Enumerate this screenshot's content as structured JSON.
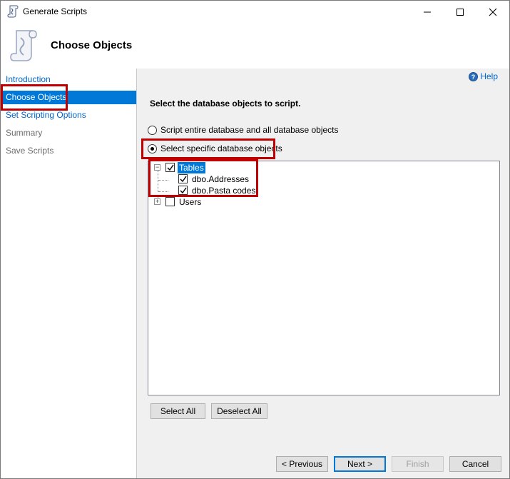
{
  "window": {
    "title": "Generate Scripts"
  },
  "header": {
    "title": "Choose Objects"
  },
  "nav": {
    "items": [
      {
        "label": "Introduction",
        "state": "link"
      },
      {
        "label": "Choose Objects",
        "state": "selected"
      },
      {
        "label": "Set Scripting Options",
        "state": "link"
      },
      {
        "label": "Summary",
        "state": "disabled"
      },
      {
        "label": "Save Scripts",
        "state": "disabled"
      }
    ]
  },
  "help": {
    "label": "Help",
    "icon": "help-icon"
  },
  "main": {
    "instructions": "Select the database objects to script.",
    "options": [
      {
        "label": "Script entire database and all database objects",
        "selected": false
      },
      {
        "label": "Select specific database objects",
        "selected": true
      }
    ],
    "tree": [
      {
        "label": "Tables",
        "checked": true,
        "expanded": true,
        "selected": true,
        "children": [
          {
            "label": "dbo.Addresses",
            "checked": true
          },
          {
            "label": "dbo.Pasta codes",
            "checked": true
          }
        ]
      },
      {
        "label": "Users",
        "checked": false,
        "expanded": false,
        "selected": false,
        "children": []
      }
    ],
    "select_all": "Select All",
    "deselect_all": "Deselect All"
  },
  "footer": {
    "previous": "< Previous",
    "next": "Next >",
    "finish": "Finish",
    "cancel": "Cancel"
  },
  "colors": {
    "accent": "#0078d7",
    "link": "#0066cc",
    "highlight": "#c00000"
  }
}
